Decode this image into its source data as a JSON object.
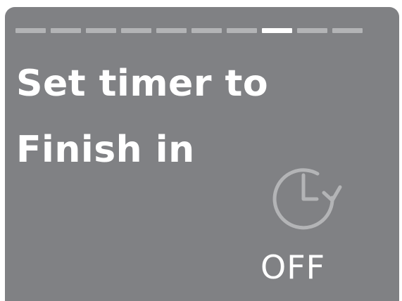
{
  "progress": {
    "total_steps": 10,
    "active_step": 8
  },
  "title": {
    "line1": "Set timer to",
    "line2": "Finish in"
  },
  "timer": {
    "icon": "timer-icon",
    "status": "OFF"
  },
  "colors": {
    "background": "#808184",
    "text": "#ffffff",
    "progress_inactive": "#b3b4b6",
    "progress_active": "#ffffff",
    "icon": "#b3b4b6"
  }
}
